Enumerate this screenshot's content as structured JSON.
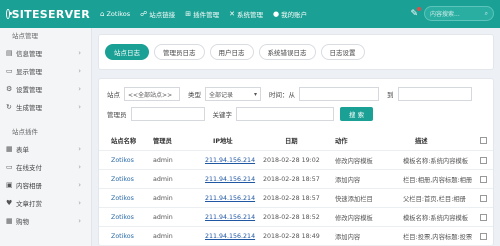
{
  "header": {
    "logo_text": "SITESERVER",
    "nav": [
      {
        "icon": "home-icon",
        "glyph": "⌂",
        "label": "Zotikos"
      },
      {
        "icon": "link-icon",
        "glyph": "☍",
        "label": "站点链接"
      },
      {
        "icon": "plugin-icon",
        "glyph": "⊞",
        "label": "插件管理"
      },
      {
        "icon": "tools-icon",
        "glyph": "✕",
        "label": "系统管理"
      },
      {
        "icon": "user-icon",
        "glyph": "●",
        "label": "我的账户"
      }
    ],
    "search_placeholder": "内容搜索..."
  },
  "sidebar": {
    "section1_title": "站点管理",
    "section1_items": [
      {
        "icon": "document-icon",
        "glyph": "▤",
        "label": "信息管理"
      },
      {
        "icon": "display-icon",
        "glyph": "▭",
        "label": "显示管理"
      },
      {
        "icon": "settings-icon",
        "glyph": "⚙",
        "label": "设置管理"
      },
      {
        "icon": "generate-icon",
        "glyph": "↻",
        "label": "生成管理"
      }
    ],
    "section2_title": "站点插件",
    "section2_items": [
      {
        "icon": "form-icon",
        "glyph": "▦",
        "label": "表单"
      },
      {
        "icon": "payment-icon",
        "glyph": "▭",
        "label": "在线支付"
      },
      {
        "icon": "album-icon",
        "glyph": "▣",
        "label": "内容相册"
      },
      {
        "icon": "reward-icon",
        "glyph": "♥",
        "label": "文章打赏"
      },
      {
        "icon": "cart-icon",
        "glyph": "▦",
        "label": "购物"
      }
    ]
  },
  "tabs": [
    "站点日志",
    "管理员日志",
    "用户日志",
    "系统错误日志",
    "日志设置"
  ],
  "filters": {
    "site_label": "站点",
    "site_value": "<<全部站点>>",
    "type_label": "类型",
    "type_value": "全部记录",
    "time_label": "时间：从",
    "to_label": "到",
    "admin_label": "管理员",
    "keyword_label": "关键字",
    "search_button": "搜 索"
  },
  "table": {
    "headers": [
      "站点名称",
      "管理员",
      "IP地址",
      "日期",
      "动作",
      "描述"
    ],
    "rows": [
      {
        "site": "Zotikos",
        "admin": "admin",
        "ip": "211.94.156.214",
        "date": "2018-02-28 19:02",
        "action": "修改内容模板",
        "desc": "模板名称:系统内容模板"
      },
      {
        "site": "Zotikos",
        "admin": "admin",
        "ip": "211.94.156.214",
        "date": "2018-02-28 18:57",
        "action": "添加内容",
        "desc": "栏目:相册,内容标题:相册"
      },
      {
        "site": "Zotikos",
        "admin": "admin",
        "ip": "211.94.156.214",
        "date": "2018-02-28 18:57",
        "action": "快速添加栏目",
        "desc": "父栏目:首页,栏目:相册"
      },
      {
        "site": "Zotikos",
        "admin": "admin",
        "ip": "211.94.156.214",
        "date": "2018-02-28 18:52",
        "action": "修改内容模板",
        "desc": "模板名称:系统内容模板"
      },
      {
        "site": "Zotikos",
        "admin": "admin",
        "ip": "211.94.156.214",
        "date": "2018-02-28 18:49",
        "action": "添加内容",
        "desc": "栏目:投票,内容标题:投票"
      }
    ]
  }
}
